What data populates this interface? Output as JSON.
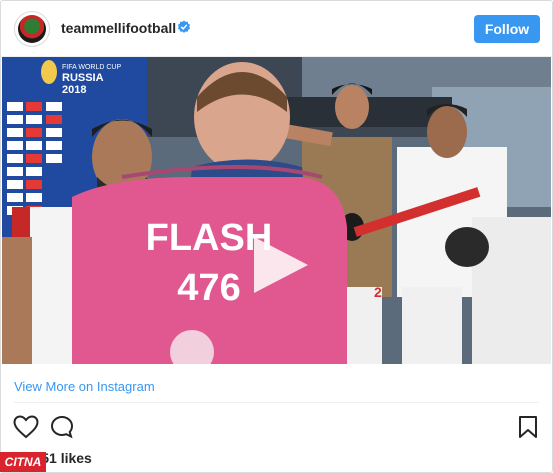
{
  "post": {
    "username": "teammellifootball",
    "follow_label": "Follow",
    "verified_icon": "verified-badge-icon",
    "view_more_label": "View More on Instagram",
    "likes_text": "67,851 likes"
  },
  "media": {
    "vest_line1": "FLASH",
    "vest_line2": "476",
    "banner_line1": "FIFA WORLD CUP",
    "banner_line2": "RUSSIA",
    "banner_line3": "2018",
    "jersey_number": "2"
  },
  "actions": {
    "like_icon": "heart-icon",
    "comment_icon": "comment-icon",
    "save_icon": "bookmark-icon"
  },
  "watermark": {
    "text": "CITNA"
  },
  "colors": {
    "accent": "#3897f0",
    "vest": "#e0588f",
    "logo": "#d9242e"
  }
}
